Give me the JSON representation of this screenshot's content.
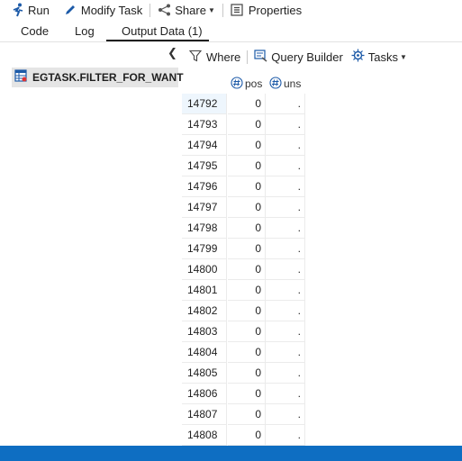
{
  "toolbar": {
    "run_label": "Run",
    "modify_label": "Modify Task",
    "share_label": "Share",
    "properties_label": "Properties"
  },
  "tabs": [
    {
      "label": "Code"
    },
    {
      "label": "Log"
    },
    {
      "label": "Output Data (1)"
    }
  ],
  "library": {
    "item_label": "EGTASK.FILTER_FOR_WANT"
  },
  "data_toolbar": {
    "where_label": "Where",
    "query_builder_label": "Query Builder",
    "tasks_label": "Tasks"
  },
  "table": {
    "columns": [
      "pos",
      "uns"
    ],
    "rows": [
      {
        "id": "14792",
        "pos": "0",
        "uns": "."
      },
      {
        "id": "14793",
        "pos": "0",
        "uns": "."
      },
      {
        "id": "14794",
        "pos": "0",
        "uns": "."
      },
      {
        "id": "14795",
        "pos": "0",
        "uns": "."
      },
      {
        "id": "14796",
        "pos": "0",
        "uns": "."
      },
      {
        "id": "14797",
        "pos": "0",
        "uns": "."
      },
      {
        "id": "14798",
        "pos": "0",
        "uns": "."
      },
      {
        "id": "14799",
        "pos": "0",
        "uns": "."
      },
      {
        "id": "14800",
        "pos": "0",
        "uns": "."
      },
      {
        "id": "14801",
        "pos": "0",
        "uns": "."
      },
      {
        "id": "14802",
        "pos": "0",
        "uns": "."
      },
      {
        "id": "14803",
        "pos": "0",
        "uns": "."
      },
      {
        "id": "14804",
        "pos": "0",
        "uns": "."
      },
      {
        "id": "14805",
        "pos": "0",
        "uns": "."
      },
      {
        "id": "14806",
        "pos": "0",
        "uns": "."
      },
      {
        "id": "14807",
        "pos": "0",
        "uns": "."
      },
      {
        "id": "14808",
        "pos": "0",
        "uns": "."
      }
    ]
  },
  "colors": {
    "accent": "#0e6ec2",
    "icon_blue": "#1c5aa8",
    "selected_row": "#eef6fd"
  }
}
